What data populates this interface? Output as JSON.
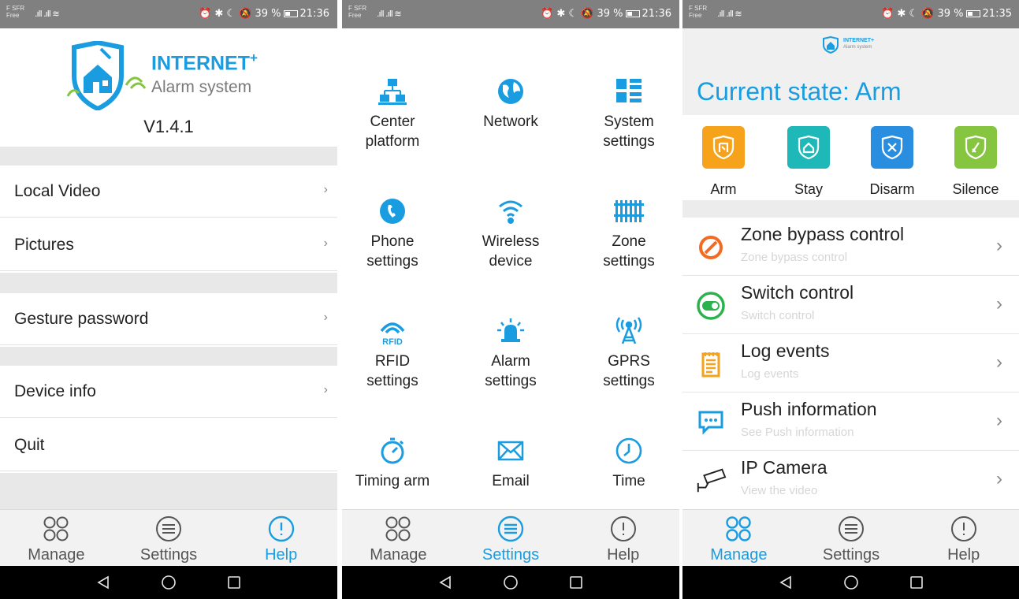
{
  "status_bars": [
    {
      "carrier_line1": "F SFR",
      "carrier_line2": "Free",
      "right_text": "⏰ ✱ ☾ 🔕 39 %",
      "time": "21:36"
    },
    {
      "carrier_line1": "F SFR",
      "carrier_line2": "Free",
      "right_text": "⏰ ✱ ☾ 🔕 39 %",
      "time": "21:36"
    },
    {
      "carrier_line1": "F SFR",
      "carrier_line2": "Free",
      "right_text": "⏰ ✱ ☾ 🔕 39 %",
      "time": "21:35"
    }
  ],
  "help_screen": {
    "logo_title": "INTERNET",
    "logo_title_sup": "+",
    "logo_subtitle": "Alarm system",
    "version": "V1.4.1",
    "menu": [
      "Local Video",
      "Pictures",
      "Gesture password",
      "Device info",
      "Quit"
    ],
    "chevron": "›"
  },
  "settings_screen": {
    "items": [
      {
        "label": "Center\nplatform",
        "icon": "network-computers-icon"
      },
      {
        "label": "Network",
        "icon": "globe-icon"
      },
      {
        "label": "System\nsettings",
        "icon": "system-grid-icon"
      },
      {
        "label": "Phone\nsettings",
        "icon": "phone-icon"
      },
      {
        "label": "Wireless\ndevice",
        "icon": "wifi-icon"
      },
      {
        "label": "Zone\nsettings",
        "icon": "fence-icon"
      },
      {
        "label": "RFID\nsettings",
        "icon": "rfid-icon"
      },
      {
        "label": "Alarm\nsettings",
        "icon": "siren-icon"
      },
      {
        "label": "GPRS\nsettings",
        "icon": "antenna-icon"
      },
      {
        "label": "Timing arm",
        "icon": "stopwatch-icon"
      },
      {
        "label": "Email",
        "icon": "envelope-icon"
      },
      {
        "label": "Time",
        "icon": "clock-icon"
      }
    ],
    "rfid_icon_text": "RFID"
  },
  "manage_screen": {
    "logo_title": "INTERNET+",
    "logo_subtitle": "Alarm system",
    "current_state": "Current state: Arm",
    "modes": [
      {
        "label": "Arm",
        "color": "#f7a21b"
      },
      {
        "label": "Stay",
        "color": "#1fb8b8"
      },
      {
        "label": "Disarm",
        "color": "#2a8ee0"
      },
      {
        "label": "Silence",
        "color": "#86c540"
      }
    ],
    "controls": [
      {
        "title": "Zone bypass control",
        "subtitle": "Zone bypass control",
        "icon": "prohibited-icon"
      },
      {
        "title": "Switch control",
        "subtitle": "Switch control",
        "icon": "toggle-icon"
      },
      {
        "title": "Log events",
        "subtitle": "Log events",
        "icon": "notepad-icon"
      },
      {
        "title": "Push information",
        "subtitle": "See Push information",
        "icon": "chat-bubble-icon"
      },
      {
        "title": "IP Camera",
        "subtitle": "View the video",
        "icon": "cctv-camera-icon"
      }
    ],
    "chevron": "›"
  },
  "tabbar": {
    "tabs": [
      "Manage",
      "Settings",
      "Help"
    ],
    "active_by_screen": [
      "Help",
      "Settings",
      "Manage"
    ]
  },
  "colors": {
    "accent": "#1a9de0",
    "statusbar": "#808080",
    "navbar": "#000000"
  }
}
